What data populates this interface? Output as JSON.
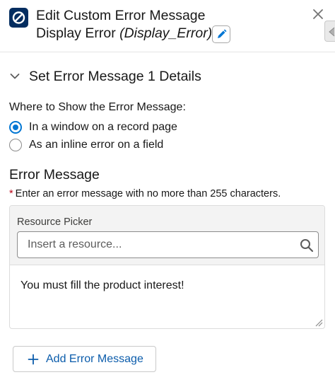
{
  "header": {
    "title_line1": "Edit Custom Error Message",
    "title_line2_label": "Display Error",
    "title_line2_api": "(Display_Error)",
    "app_icon": "no-entry-icon",
    "edit_icon": "pencil-icon",
    "close_icon": "close-icon"
  },
  "section": {
    "title": "Set Error Message 1 Details",
    "icon": "chevron-down-icon"
  },
  "location": {
    "label": "Where to Show the Error Message:",
    "options": [
      {
        "label": "In a window on a record page",
        "selected": true
      },
      {
        "label": "As an inline error on a field",
        "selected": false
      }
    ]
  },
  "error_message": {
    "title": "Error Message",
    "required_marker": "*",
    "required_text": "Enter an error message with no more than 255 characters.",
    "resource_picker_label": "Resource Picker",
    "resource_picker_placeholder": "Insert a resource...",
    "body": "You must fill the product interest!"
  },
  "actions": {
    "add_label": "Add Error Message",
    "add_icon": "plus-icon"
  },
  "colors": {
    "brand_dark": "#032d60",
    "accent": "#0176d3",
    "link": "#0b5cab",
    "required": "#ba0517"
  }
}
